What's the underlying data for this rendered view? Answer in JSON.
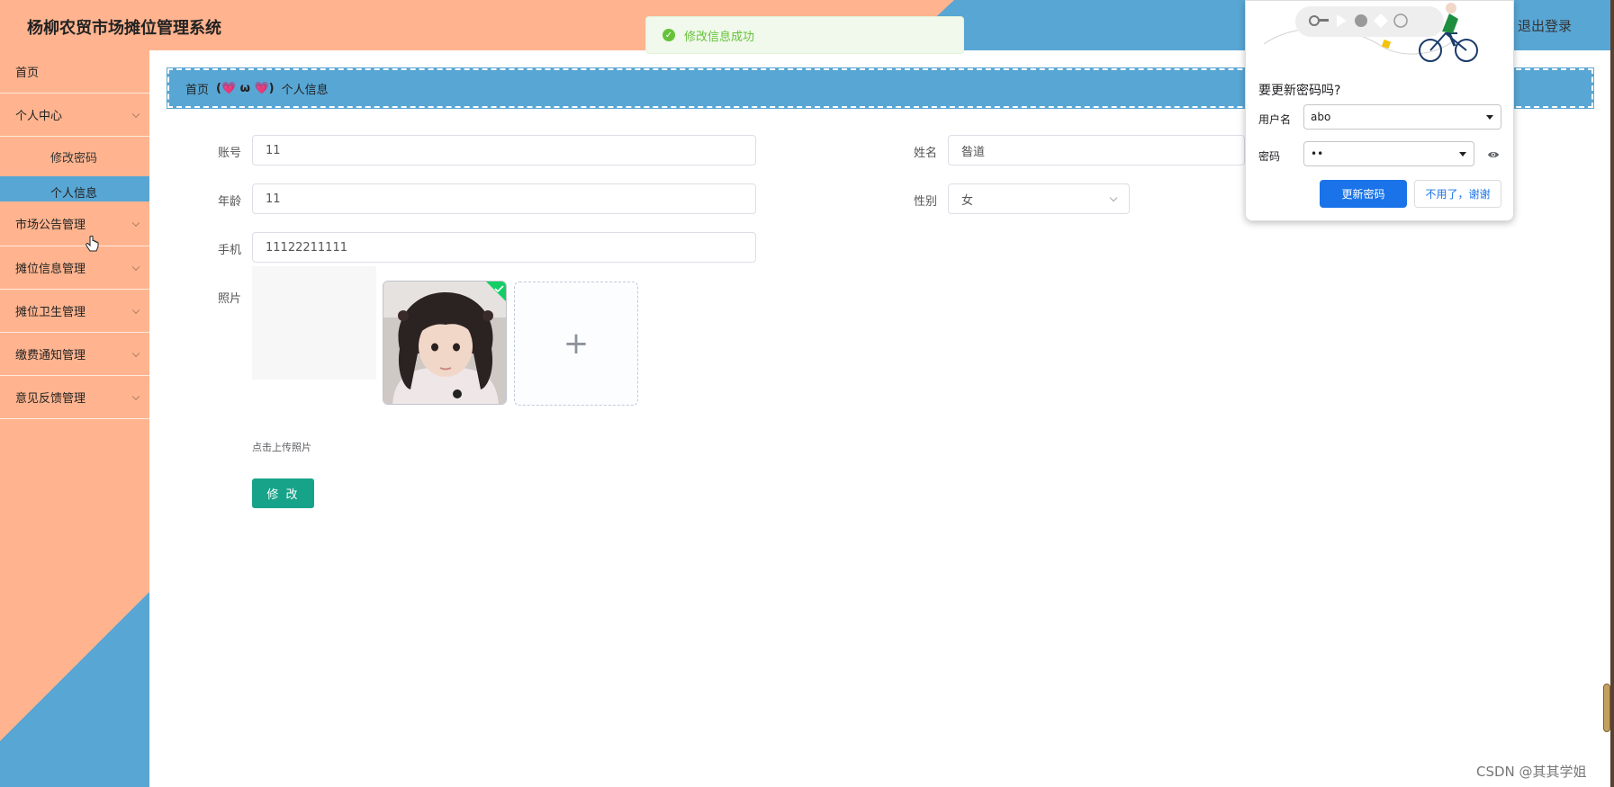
{
  "header": {
    "app_title": "杨柳农贸市场摊位管理系统",
    "logout": "退出登录"
  },
  "toast": {
    "message": "修改信息成功"
  },
  "sidebar": {
    "home": "首页",
    "personal_center": "个人中心",
    "change_password": "修改密码",
    "personal_info": "个人信息",
    "items": [
      {
        "label": "市场公告管理"
      },
      {
        "label": "摊位信息管理"
      },
      {
        "label": "摊位卫生管理"
      },
      {
        "label": "缴费通知管理"
      },
      {
        "label": "意见反馈管理"
      }
    ]
  },
  "breadcrumb": {
    "home": "首页",
    "separator": "(💗 ω 💗)",
    "current": "个人信息"
  },
  "form": {
    "account_label": "账号",
    "account_value": "11",
    "name_label": "姓名",
    "name_value": "昝道",
    "age_label": "年龄",
    "age_value": "11",
    "gender_label": "性别",
    "gender_value": "女",
    "phone_label": "手机",
    "phone_value": "11122211111",
    "photo_label": "照片",
    "upload_tip": "点击上传照片",
    "submit_label": "修 改"
  },
  "password_prompt": {
    "title": "要更新密码吗?",
    "username_label": "用户名",
    "username_value": "abo",
    "password_label": "密码",
    "password_value": "••",
    "update_button": "更新密码",
    "decline_button": "不用了，谢谢"
  },
  "watermark": "CSDN @其其学姐",
  "colors": {
    "peach": "#ffb48f",
    "blue": "#58a6d4",
    "submit": "#16a389",
    "google_blue": "#1a73e8"
  }
}
